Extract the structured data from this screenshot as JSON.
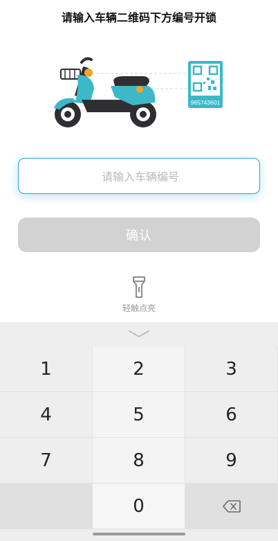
{
  "header": {
    "title": "请输入车辆二维码下方编号开锁"
  },
  "illustration": {
    "qr_code_number": "965743601"
  },
  "form": {
    "input_placeholder": "请输入车辆编号",
    "input_value": "",
    "confirm_label": "确认"
  },
  "flashlight": {
    "label": "轻触点亮"
  },
  "keypad": {
    "keys": [
      "1",
      "2",
      "3",
      "4",
      "5",
      "6",
      "7",
      "8",
      "9",
      "",
      "0",
      ""
    ],
    "delete_icon": "backspace-icon",
    "collapse_icon": "chevron-down-icon"
  },
  "colors": {
    "accent": "#2aa3d8",
    "scooter_teal": "#3cb8c9",
    "button_disabled": "#d2d2d2",
    "keyboard_bg": "#eeeeee"
  }
}
